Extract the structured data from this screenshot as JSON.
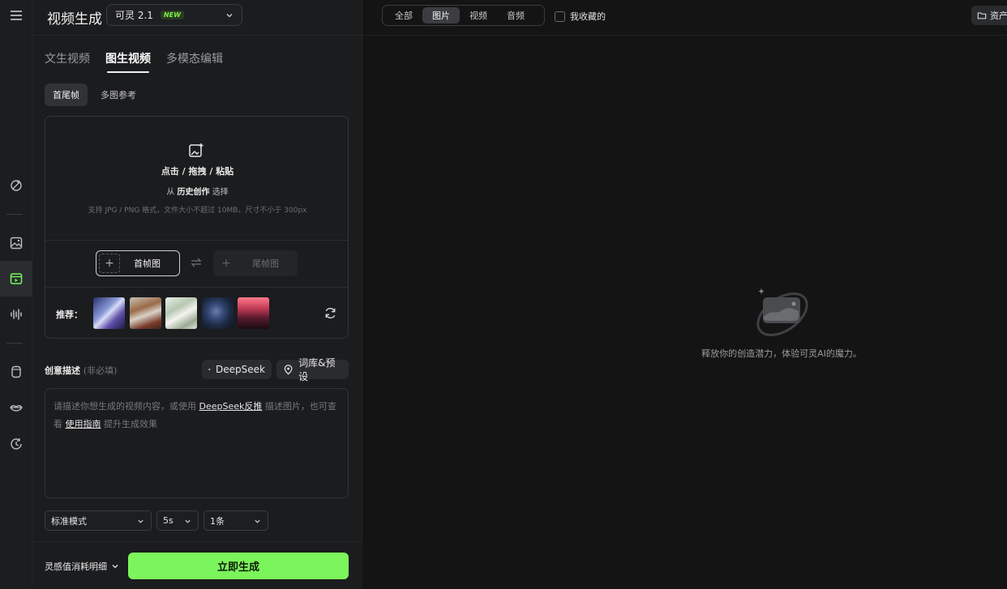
{
  "header": {
    "title": "视频生成",
    "model": "可灵 2.1",
    "model_badge": "NEW"
  },
  "tabs": [
    "文生视频",
    "图生视频",
    "多模态编辑"
  ],
  "active_tab": "图生视频",
  "subtabs": [
    "首尾帧",
    "多图参考"
  ],
  "upload": {
    "main": "点击 / 拖拽 / 粘贴",
    "from": "从",
    "history": "历史创作",
    "choose": "选择",
    "note": "支持 JPG / PNG 格式，文件大小不超过 10MB，尺寸不小于 300px",
    "first_frame": "首帧图",
    "last_frame": "尾帧图",
    "recommend": "推荐："
  },
  "description": {
    "label": "创意描述",
    "optional": "(非必填)",
    "deepseek": "DeepSeek",
    "presets": "词库&预设",
    "placeholder_1": "请描述你想生成的视频内容，或使用",
    "placeholder_link": "DeepSeek反推",
    "placeholder_2": "描述图片，也可查",
    "placeholder_3": "看",
    "guide_link": "使用指南",
    "placeholder_4": "提升生成效果"
  },
  "settings": {
    "mode": "标准模式",
    "duration": "5s",
    "count": "1条"
  },
  "footer": {
    "cost": "灵感值消耗明细",
    "generate": "立即生成"
  },
  "filters": [
    "全部",
    "图片",
    "视频",
    "音频"
  ],
  "active_filter": "图片",
  "favorites": "我收藏的",
  "assets": "资产",
  "empty_text": "释放你的创造潜力，体验可灵AI的魔力。",
  "colors": {
    "accent": "#7bf55b",
    "background": "#141414",
    "panel": "#1b1c1e"
  }
}
